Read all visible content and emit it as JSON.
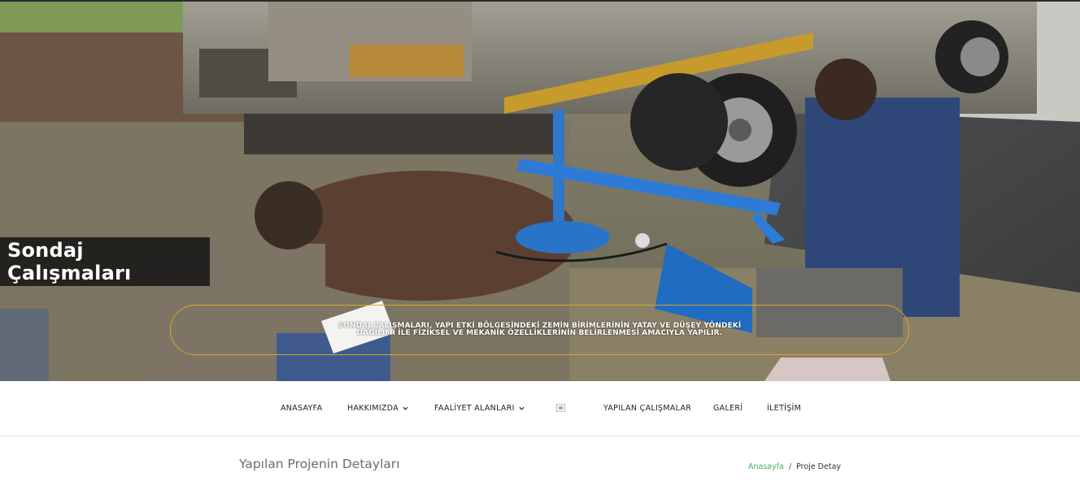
{
  "hero": {
    "title": "Sondaj Çalışmaları",
    "caption": "SONDAJ ÇALIŞMALARI, YAPI ETKİ BÖLGESİNDEKİ ZEMİN BİRİMLERİNİN YATAY VE DÜŞEY YÖNDEKİ DAĞILIMI İLE FİZİKSEL VE MEKANİK ÖZELLİKLERİNİN BELİRLENMESİ AMACIYLA YAPILIR.",
    "accent": "#d9a52a"
  },
  "nav": {
    "items": [
      {
        "label": "ANASAYFA"
      },
      {
        "label": "HAKKIMIZDA",
        "has_dropdown": true
      },
      {
        "label": "FAALİYET ALANLARI",
        "has_dropdown": true
      },
      {
        "label": "YAPILAN ÇALIŞMALAR"
      },
      {
        "label": "GALERİ"
      },
      {
        "label": "İLETİŞİM"
      }
    ],
    "logo_icon": "broken-image-icon",
    "caret_icon": "chevron-down-icon"
  },
  "content": {
    "page_title": "Yapılan Projenin Detayları",
    "breadcrumb": {
      "home": "Anasayfa",
      "separator": "/",
      "current": "Proje Detay",
      "link_color": "#4bae4f"
    }
  }
}
